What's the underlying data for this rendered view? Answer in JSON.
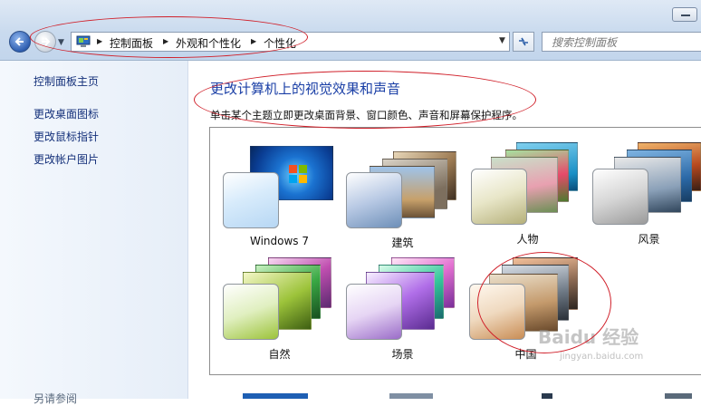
{
  "window": {
    "minimize_label": ""
  },
  "address_bar": {
    "crumbs": [
      "控制面板",
      "外观和个性化",
      "个性化"
    ]
  },
  "search": {
    "placeholder": "搜索控制面板"
  },
  "sidebar": {
    "home_link": "控制面板主页",
    "links": [
      "更改桌面图标",
      "更改鼠标指针",
      "更改帐户图片"
    ],
    "see_also": "另请参阅"
  },
  "main": {
    "title": "更改计算机上的视觉效果和声音",
    "subtitle": "单击某个主题立即更改桌面背景、窗口颜色、声音和屏幕保护程序。"
  },
  "themes": [
    {
      "label": "Windows 7",
      "accent": "#1e6fd2"
    },
    {
      "label": "建筑",
      "accent": "#6d8fb8"
    },
    {
      "label": "人物",
      "accent": "#b5b07a"
    },
    {
      "label": "风景",
      "accent": "#9a9a9a"
    },
    {
      "label": "自然",
      "accent": "#9cc33a"
    },
    {
      "label": "场景",
      "accent": "#9a6cc8"
    },
    {
      "label": "中国",
      "accent": "#c98d55"
    }
  ],
  "watermark": {
    "text": "Baidu 经验",
    "sub": "jingyan.baidu.com"
  },
  "colors": {
    "link": "#14307a",
    "title": "#1a3fa6",
    "annotation": "#d0202a"
  }
}
